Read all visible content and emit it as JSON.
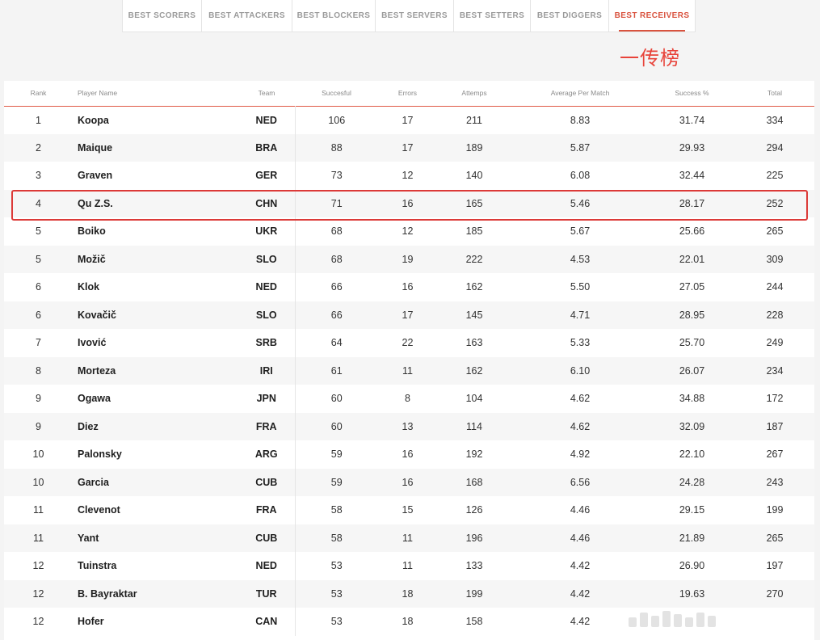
{
  "tabs": [
    {
      "label": "BEST SCORERS",
      "active": false
    },
    {
      "label": "BEST ATTACKERS",
      "active": false
    },
    {
      "label": "BEST BLOCKERS",
      "active": false
    },
    {
      "label": "BEST SERVERS",
      "active": false
    },
    {
      "label": "BEST SETTERS",
      "active": false
    },
    {
      "label": "BEST DIGGERS",
      "active": false
    },
    {
      "label": "BEST RECEIVERS",
      "active": true
    }
  ],
  "annotation": "一传榜",
  "accent_color": "#d9533f",
  "highlight_color": "#dc3a38",
  "table": {
    "columns": [
      "Rank",
      "Player Name",
      "Team",
      "Succesful",
      "Errors",
      "Attemps",
      "Average Per Match",
      "Success %",
      "Total"
    ],
    "highlighted_row": 3,
    "rows": [
      [
        "1",
        "Koopa",
        "NED",
        "106",
        "17",
        "211",
        "8.83",
        "31.74",
        "334"
      ],
      [
        "2",
        "Maique",
        "BRA",
        "88",
        "17",
        "189",
        "5.87",
        "29.93",
        "294"
      ],
      [
        "3",
        "Graven",
        "GER",
        "73",
        "12",
        "140",
        "6.08",
        "32.44",
        "225"
      ],
      [
        "4",
        "Qu Z.S.",
        "CHN",
        "71",
        "16",
        "165",
        "5.46",
        "28.17",
        "252"
      ],
      [
        "5",
        "Boiko",
        "UKR",
        "68",
        "12",
        "185",
        "5.67",
        "25.66",
        "265"
      ],
      [
        "5",
        "Možič",
        "SLO",
        "68",
        "19",
        "222",
        "4.53",
        "22.01",
        "309"
      ],
      [
        "6",
        "Klok",
        "NED",
        "66",
        "16",
        "162",
        "5.50",
        "27.05",
        "244"
      ],
      [
        "6",
        "Kovačič",
        "SLO",
        "66",
        "17",
        "145",
        "4.71",
        "28.95",
        "228"
      ],
      [
        "7",
        "Ivović",
        "SRB",
        "64",
        "22",
        "163",
        "5.33",
        "25.70",
        "249"
      ],
      [
        "8",
        "Morteza",
        "IRI",
        "61",
        "11",
        "162",
        "6.10",
        "26.07",
        "234"
      ],
      [
        "9",
        "Ogawa",
        "JPN",
        "60",
        "8",
        "104",
        "4.62",
        "34.88",
        "172"
      ],
      [
        "9",
        "Diez",
        "FRA",
        "60",
        "13",
        "114",
        "4.62",
        "32.09",
        "187"
      ],
      [
        "10",
        "Palonsky",
        "ARG",
        "59",
        "16",
        "192",
        "4.92",
        "22.10",
        "267"
      ],
      [
        "10",
        "Garcia",
        "CUB",
        "59",
        "16",
        "168",
        "6.56",
        "24.28",
        "243"
      ],
      [
        "11",
        "Clevenot",
        "FRA",
        "58",
        "15",
        "126",
        "4.46",
        "29.15",
        "199"
      ],
      [
        "11",
        "Yant",
        "CUB",
        "58",
        "11",
        "196",
        "4.46",
        "21.89",
        "265"
      ],
      [
        "12",
        "Tuinstra",
        "NED",
        "53",
        "11",
        "133",
        "4.42",
        "26.90",
        "197"
      ],
      [
        "12",
        "B. Bayraktar",
        "TUR",
        "53",
        "18",
        "199",
        "4.42",
        "19.63",
        "270"
      ],
      [
        "12",
        "Hofer",
        "CAN",
        "53",
        "18",
        "158",
        "4.42",
        "",
        ""
      ]
    ]
  }
}
